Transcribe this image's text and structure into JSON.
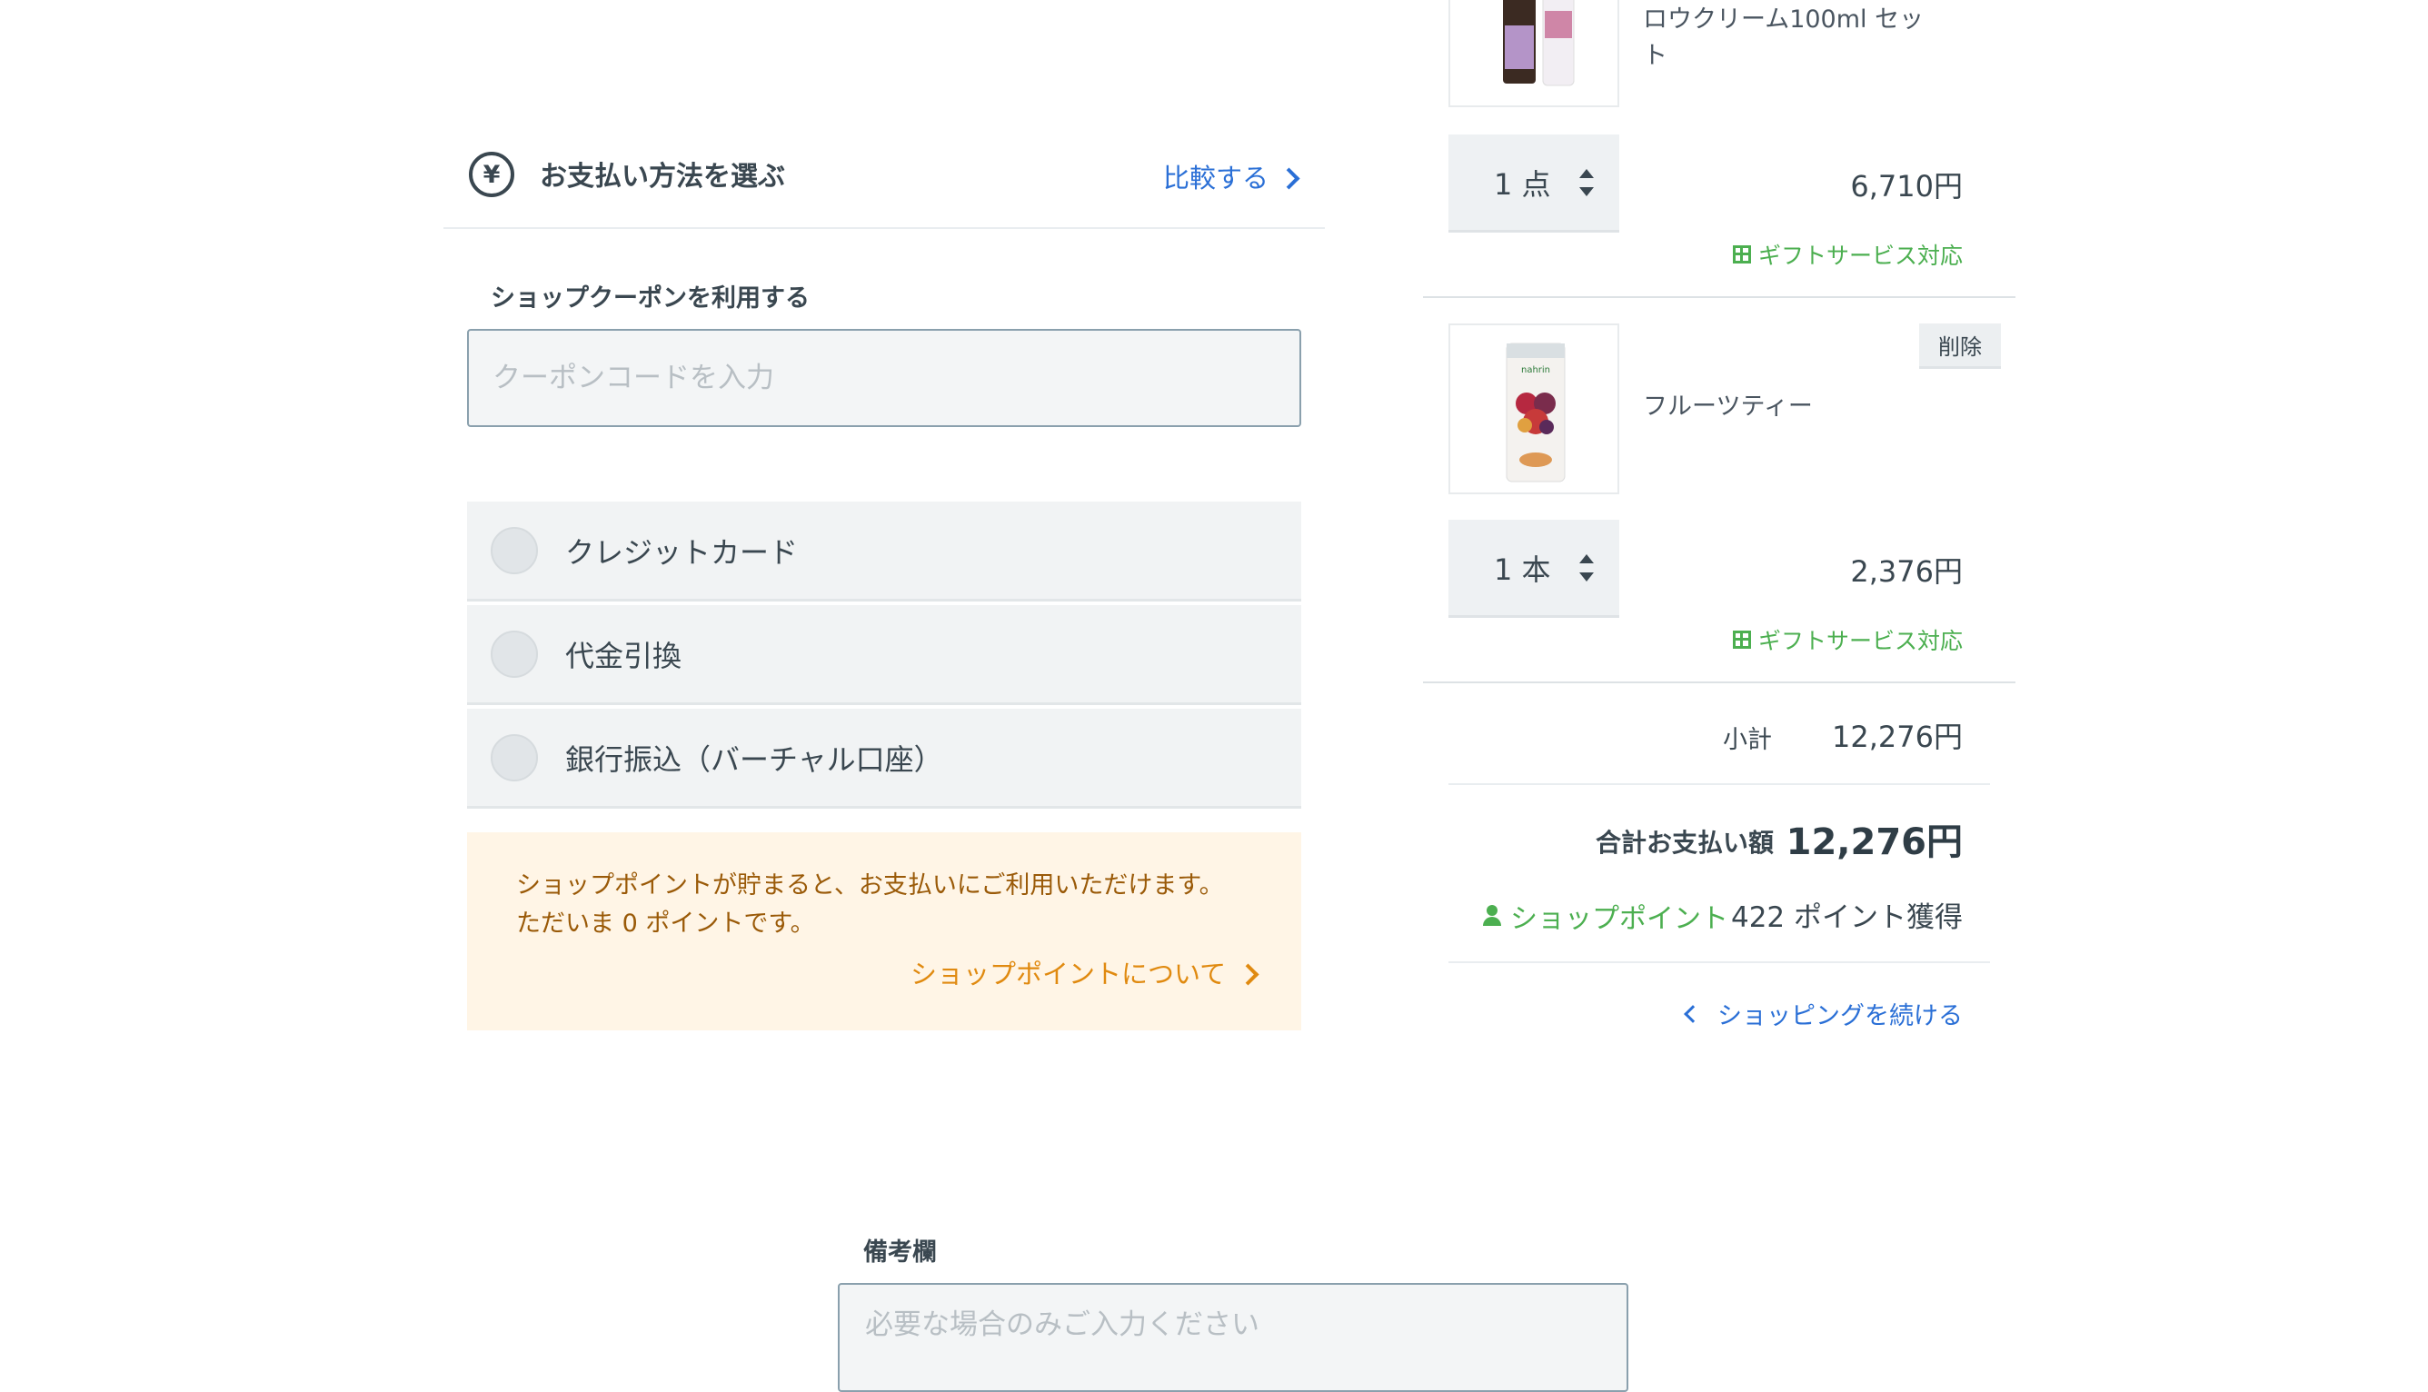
{
  "payment": {
    "title": "お支払い方法を選ぶ",
    "compare_label": "比較する",
    "coupon_label": "ショップクーポンを利用する",
    "coupon_placeholder": "クーポンコードを入力",
    "options": [
      {
        "label": "クレジットカード"
      },
      {
        "label": "代金引換"
      },
      {
        "label": "銀行振込（バーチャル口座）"
      }
    ],
    "point_message_line1": "ショップポイントが貯まると、お支払いにご利用いただけます。",
    "point_message_line2": "ただいま 0 ポイントです。",
    "point_link": "ショップポイントについて"
  },
  "cart": {
    "items": [
      {
        "name_line1": "ロウクリーム100ml セッ",
        "name_line2": "ト",
        "qty": "1 点",
        "price": "6,710円",
        "gift": "ギフトサービス対応"
      },
      {
        "name": "フルーツティー",
        "delete": "削除",
        "qty": "1 本",
        "price": "2,376円",
        "gift": "ギフトサービス対応"
      }
    ],
    "subtotal_label": "小計",
    "subtotal_value": "12,276円",
    "total_label": "合計お支払い額",
    "total_value": "12,276円",
    "shop_point_label": "ショップポイント",
    "shop_point_value": "422 ポイント獲得",
    "continue_label": "ショッピングを続ける"
  },
  "notes": {
    "label": "備考欄",
    "placeholder": "必要な場合のみご入力ください"
  },
  "colors": {
    "link_blue": "#2a6fd6",
    "gift_green": "#4caf50",
    "point_orange": "#e08a10",
    "point_bg": "#fff5e6"
  }
}
